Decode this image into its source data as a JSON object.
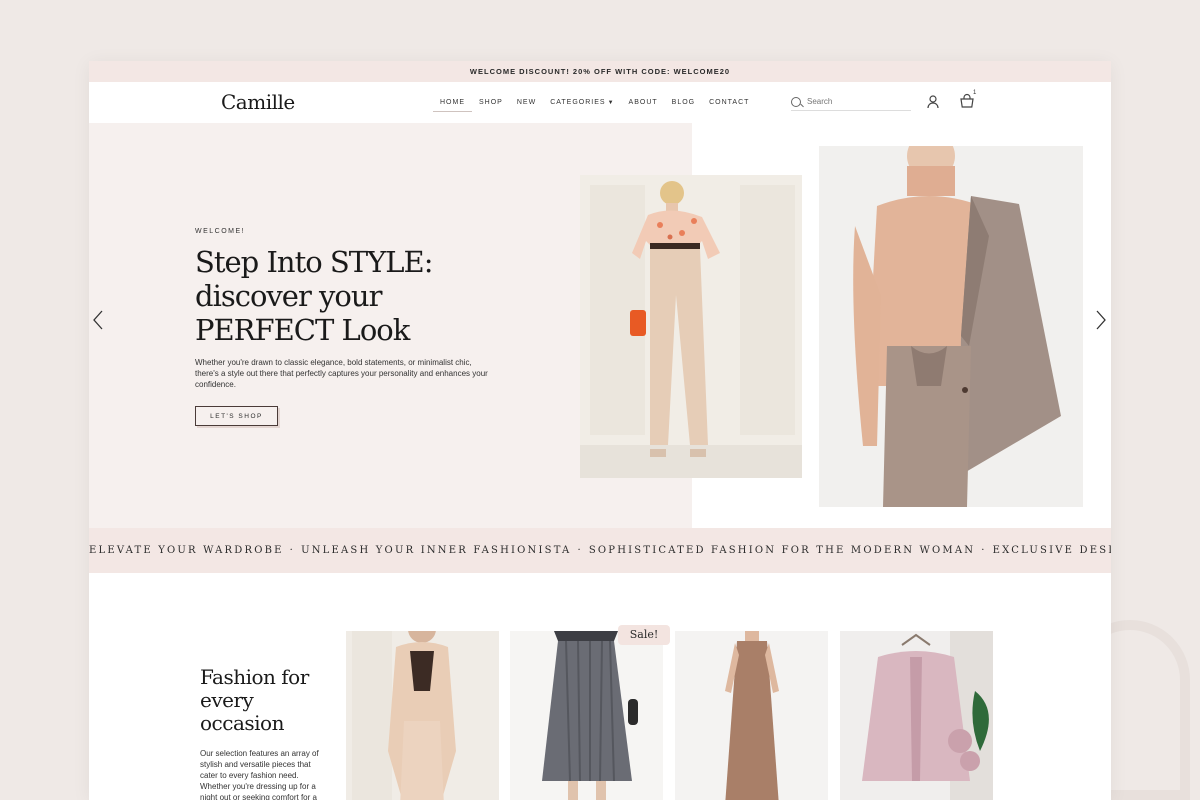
{
  "promo": {
    "text": "WELCOME DISCOUNT! 20% OFF WITH CODE: WELCOME20"
  },
  "header": {
    "logo": "Camille",
    "nav": [
      {
        "label": "HOME"
      },
      {
        "label": "SHOP"
      },
      {
        "label": "NEW"
      },
      {
        "label": "CATEGORIES"
      },
      {
        "label": "ABOUT"
      },
      {
        "label": "BLOG"
      },
      {
        "label": "CONTACT"
      }
    ],
    "search_placeholder": "Search",
    "cart_count": "1"
  },
  "hero": {
    "eyebrow": "WELCOME!",
    "title": "Step Into STYLE: discover your PERFECT Look",
    "text": "Whether you're drawn to classic elegance, bold statements, or minimalist chic, there's a style out there that perfectly captures your personality and enhances your confidence.",
    "button": "LET'S SHOP"
  },
  "marquee": {
    "items": [
      "ELEVATE YOUR WARDROBE",
      "UNLEASH YOUR INNER FASHIONISTA",
      "SOPHISTICATED FASHION FOR THE MODERN WOMAN",
      "EXCLUSIVE DESIGNS TO MAKE YOU SH"
    ]
  },
  "section": {
    "title": "Fashion for every occasion",
    "text": "Our selection features an array of stylish and versatile pieces that cater to every fashion need. Whether you're dressing up for a night out or seeking comfort for a",
    "sale_badge": "Sale!"
  },
  "colors": {
    "accent": "#f3e7e4",
    "hero_bg": "#f6f0ee",
    "text": "#1a1a1a"
  }
}
